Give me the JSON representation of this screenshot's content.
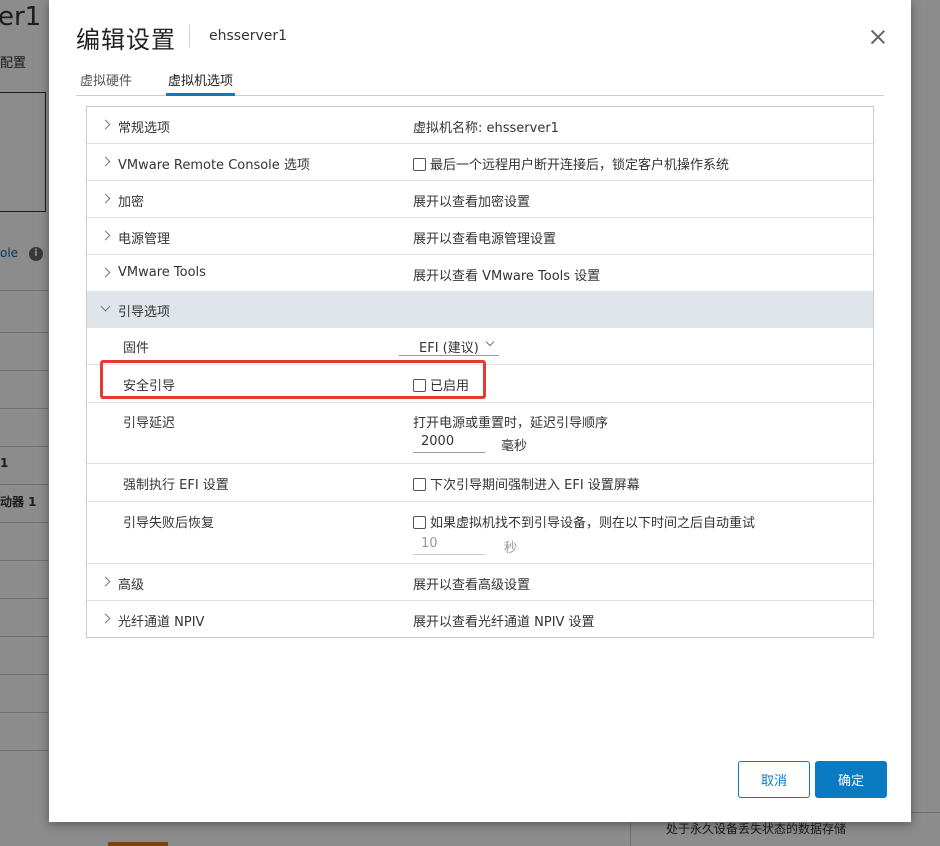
{
  "background": {
    "title_fragment": "er1",
    "config_fragment": "配置",
    "console_fragment": "ole",
    "info_icon": "info-icon",
    "row1_fragment": "1",
    "row2_fragment": "动器 1",
    "bottom_text": "处于永久设备丢失状态的数据存储"
  },
  "dialog": {
    "title": "编辑设置",
    "subtitle": "ehsserver1",
    "close_icon": "close-icon",
    "tabs": [
      {
        "label": "虚拟硬件",
        "active": false
      },
      {
        "label": "虚拟机选项",
        "active": true
      }
    ],
    "sections": {
      "general": {
        "label": "常规选项",
        "value": "虚拟机名称: ehsserver1"
      },
      "vmrc": {
        "label": "VMware Remote Console 选项",
        "value": "最后一个远程用户断开连接后，锁定客户机操作系统",
        "checked": false
      },
      "encryption": {
        "label": "加密",
        "value": "展开以查看加密设置"
      },
      "power": {
        "label": "电源管理",
        "value": "展开以查看电源管理设置"
      },
      "tools": {
        "label": "VMware Tools",
        "value": "展开以查看 VMware Tools 设置"
      },
      "boot": {
        "label": "引导选项",
        "firmware": {
          "label": "固件",
          "value": "EFI (建议)"
        },
        "secure_boot": {
          "label": "安全引导",
          "value": "已启用",
          "checked": false
        },
        "boot_delay": {
          "label": "引导延迟",
          "description": "打开电源或重置时，延迟引导顺序",
          "value": "2000",
          "unit": "毫秒"
        },
        "force_efi": {
          "label": "强制执行 EFI 设置",
          "value": "下次引导期间强制进入 EFI 设置屏幕",
          "checked": false
        },
        "failed_boot": {
          "label": "引导失败后恢复",
          "value": "如果虚拟机找不到引导设备，则在以下时间之后自动重试",
          "checked": false,
          "retry_value": "10",
          "unit": "秒"
        }
      },
      "advanced": {
        "label": "高级",
        "value": "展开以查看高级设置"
      },
      "npiv": {
        "label": "光纤通道 NPIV",
        "value": "展开以查看光纤通道 NPIV 设置"
      }
    },
    "buttons": {
      "cancel": "取消",
      "ok": "确定"
    },
    "colors": {
      "accent": "#0a7ac2",
      "highlight": "#e53a2f",
      "expanded_row": "#dfe5ea"
    }
  }
}
